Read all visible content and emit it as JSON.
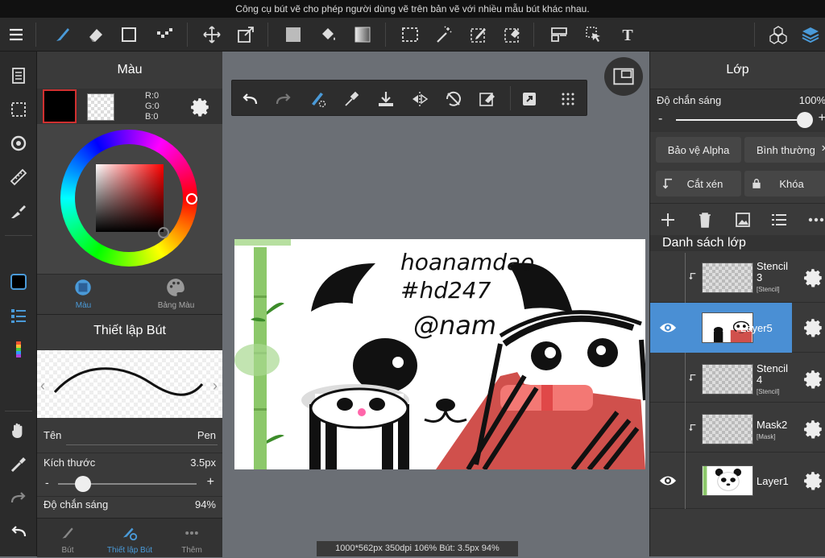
{
  "tooltip": "Công cụ bút vẽ cho phép người dùng vẽ trên bản vẽ với nhiều mẫu bút khác nhau.",
  "color_panel": {
    "title": "Màu",
    "rgb_r": "R:0",
    "rgb_g": "G:0",
    "rgb_b": "B:0",
    "tab_color": "Màu",
    "tab_palette": "Bảng Màu"
  },
  "brush_panel": {
    "title": "Thiết lập Bút",
    "name_label": "Tên",
    "name_value": "Pen",
    "size_label": "Kích thước",
    "size_value": "3.5px",
    "size_fraction": 0.18,
    "opacity_label": "Độ chắn sáng",
    "opacity_value": "94%",
    "minus": "-",
    "plus": "+",
    "bottom_tabs": [
      "Bút",
      "Thiết lập Bút",
      "Thêm"
    ]
  },
  "canvas": {
    "artwork_text": [
      "hoanamdao",
      "#hd247",
      "@nam"
    ],
    "status": "1000*562px 350dpi 106% Bút: 3.5px 94%"
  },
  "layer_panel": {
    "title": "Lớp",
    "opacity_label": "Độ chắn sáng",
    "opacity_value": "100%",
    "opacity_fraction": 1.0,
    "minus": "-",
    "plus": "+",
    "alpha_protect": "Bảo vệ Alpha",
    "blend_mode": "Bình thường",
    "clipping": "Cắt xén",
    "lock": "Khóa",
    "list_title": "Danh sách lớp",
    "layers": [
      {
        "name_line1": "Stencil",
        "name_line2": "3",
        "sub": "[Stencil]"
      },
      {
        "name_line1": "Layer5",
        "name_line2": "",
        "sub": ""
      },
      {
        "name_line1": "Stencil",
        "name_line2": "4",
        "sub": "[Stencil]"
      },
      {
        "name_line1": "Mask2",
        "name_line2": "",
        "sub": "[Mask]"
      },
      {
        "name_line1": "Layer1",
        "name_line2": "",
        "sub": ""
      }
    ]
  },
  "colors": {
    "accent": "#4a90d9",
    "selected_layer": "#4a8fd4",
    "panel_bg": "#3a3a3a",
    "toolbar_bg": "#2b2b2b",
    "canvas_bg": "#6b6f75",
    "red_frame": "#d03030"
  },
  "icons": {
    "toolbar": [
      "menu-icon",
      "brush-icon",
      "eraser-icon",
      "rectangle-icon",
      "dot-brush-icon",
      "move-icon",
      "transform-icon",
      "fill-color-icon",
      "bucket-icon",
      "gradient-icon",
      "select-rect-icon",
      "magic-wand-icon",
      "select-pen-icon",
      "select-eraser-icon",
      "layout-icon",
      "select-arrow-icon",
      "text-icon",
      "3d-cubes-icon",
      "layers-icon"
    ],
    "left": [
      "pages-icon",
      "selection-icon",
      "rotate-icon",
      "ruler-icon",
      "eyedrop-fill-icon",
      "color-swatch-icon",
      "layers-list-icon",
      "gradient-strip-icon",
      "hand-icon",
      "eyedropper-icon",
      "redo-icon",
      "undo-icon"
    ],
    "canvas_toolbar": [
      "undo-icon",
      "redo-icon",
      "snap-icon",
      "eyedropper-icon",
      "save-icon",
      "flip-icon",
      "rotate-reset-icon",
      "clear-icon",
      "share-icon",
      "grid-menu-icon"
    ]
  }
}
